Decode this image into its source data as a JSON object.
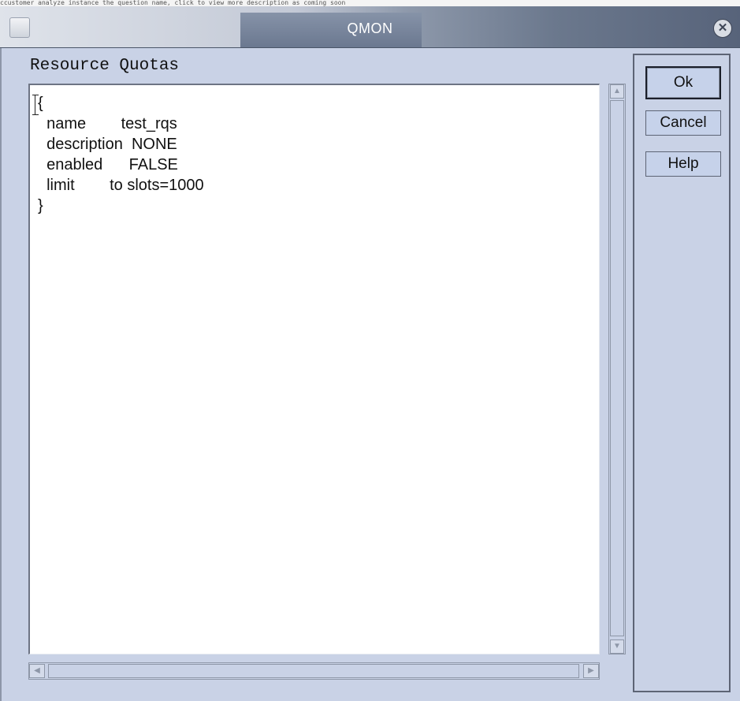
{
  "top_strip_text": "ccustomer analyze instance the question name, click to view more description as coming soon",
  "window": {
    "title": "QMON",
    "close_icon": "close-icon"
  },
  "section_label": "Resource Quotas",
  "rule_text": "{\n  name        test_rqs\n  description  NONE\n  enabled      FALSE\n  limit        to slots=1000\n}",
  "buttons": {
    "ok": "Ok",
    "cancel": "Cancel",
    "help": "Help"
  },
  "colors": {
    "background": "#c9d2e6",
    "button": "#c6d2ea",
    "text_area": "#ffffff"
  }
}
